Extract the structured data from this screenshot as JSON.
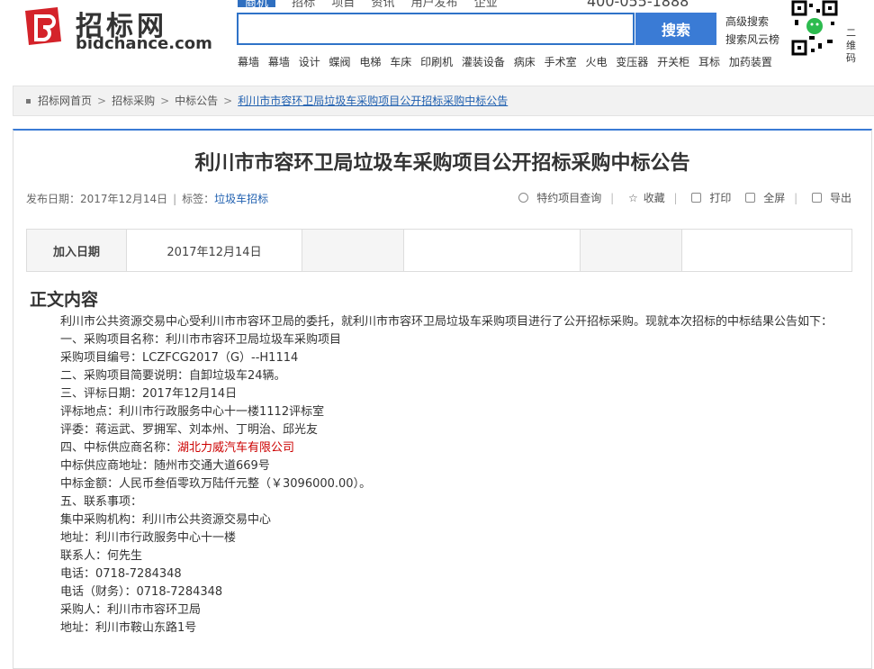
{
  "header": {
    "logo_cn": "招标网",
    "logo_en": "bidchance.com",
    "top_nav": [
      "商机",
      "招标",
      "项目",
      "资讯",
      "用户发布",
      "企业"
    ],
    "hotline": "400-055-1888",
    "search_button": "搜索",
    "advanced_search": "高级搜索",
    "search_rank": "搜索风云榜",
    "hot_keywords": [
      "幕墙",
      "幕墙",
      "设计",
      "蝶阀",
      "电梯",
      "车床",
      "印刷机",
      "灌装设备",
      "病床",
      "手术室",
      "火电",
      "变压器",
      "开关柜",
      "耳标",
      "加药装置"
    ],
    "side_text": "二维码"
  },
  "breadcrumb": {
    "items": [
      "招标网首页",
      "招标采购",
      "中标公告"
    ],
    "current": "利川市市容环卫局垃圾车采购项目公开招标采购中标公告"
  },
  "article": {
    "title": "利川市市容环卫局垃圾车采购项目公开招标采购中标公告",
    "publish_label": "发布日期：",
    "publish_date": "2017年12月14日",
    "tag_label": "标签：",
    "tag": "垃圾车招标",
    "tools": {
      "query": "特约项目查询",
      "favorite": "收藏",
      "print": "打印",
      "fullscreen": "全屏",
      "export": "导出"
    },
    "info_table": {
      "added_label": "加入日期",
      "added_value": "2017年12月14日"
    },
    "section_title": "正文内容",
    "intro": "利川市公共资源交易中心受利川市市容环卫局的委托，就利川市市容环卫局垃圾车采购项目进行了公开招标采购。现就本次招标的中标结果公告如下：",
    "lines": [
      "一、采购项目名称：利川市市容环卫局垃圾车采购项目",
      "采购项目编号：LCZFCG2017（G）--H1114",
      "二、采购项目简要说明：自卸垃圾车24辆。",
      "三、评标日期：2017年12月14日",
      "评标地点：利川市行政服务中心十一楼1112评标室",
      "评委：蒋运武、罗拥军、刘本州、丁明治、邱光友"
    ],
    "winner_label": "四、中标供应商名称：",
    "winner": "湖北力威汽车有限公司",
    "lines2": [
      "中标供应商地址：随州市交通大道669号",
      "中标金额：人民币叁佰零玖万陆仟元整（￥3096000.00）。",
      "五、联系事项：",
      "集中采购机构：利川市公共资源交易中心",
      "地址：利川市行政服务中心十一楼",
      "联系人：何先生",
      "电话：0718-7284348",
      "电话（财务）：0718-7284348",
      "采购人：利川市市容环卫局",
      "地址：利川市鞍山东路1号"
    ]
  },
  "colors": {
    "accent": "#3a7bd5",
    "link": "#2060b0",
    "winner": "#cc0000",
    "logo_red": "#d4232a"
  }
}
